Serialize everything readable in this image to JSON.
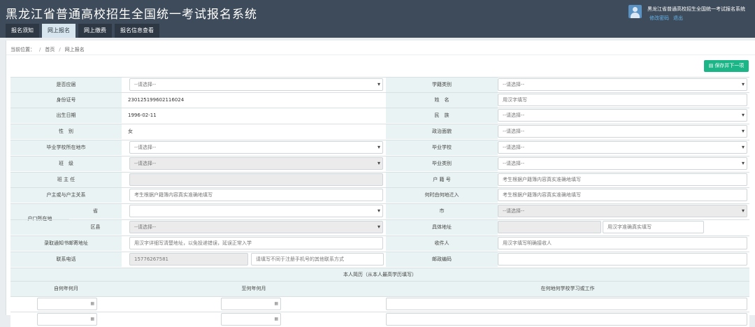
{
  "header": {
    "title": "黑龙江省普通高校招生全国统一考试报名系统",
    "user_name": "黑龙江省普通高校招生全国统一考试报名系统",
    "link_change_pwd": "修改密码",
    "link_logout": "退出"
  },
  "nav": [
    {
      "label": "报名须知",
      "active": false
    },
    {
      "label": "网上报名",
      "active": true
    },
    {
      "label": "网上缴费",
      "active": false
    },
    {
      "label": "报名信息查看",
      "active": false
    }
  ],
  "breadcrumb": {
    "prefix": "当前位置：",
    "home": "首页",
    "current": "网上报名"
  },
  "save_button": "保存并下一项",
  "placeholder_select": "--请选择--",
  "form": {
    "shifou_yingjie": {
      "label": "是否应届",
      "value": "--请选择--"
    },
    "xueji_leibie": {
      "label": "学籍类别",
      "value": "--请选择--"
    },
    "id_number": {
      "label": "身份证号",
      "value": "230125199602116024"
    },
    "name": {
      "label": "姓　名",
      "placeholder": "用汉字填写"
    },
    "birth": {
      "label": "出生日期",
      "value": "1996-02-11"
    },
    "ethnic": {
      "label": "民　族",
      "value": "--请选择--"
    },
    "gender": {
      "label": "性　别",
      "value": "女"
    },
    "politics": {
      "label": "政治面貌",
      "value": "--请选择--"
    },
    "school_location": {
      "label": "毕业学校所在地市",
      "value": "--请选择--"
    },
    "school": {
      "label": "毕业学校",
      "value": "--请选择--"
    },
    "class": {
      "label": "班　级",
      "value": "--请选择--"
    },
    "grad_type": {
      "label": "毕业类别",
      "value": "--请选择--"
    },
    "teacher": {
      "label": "班 主 任",
      "value": ""
    },
    "hukou_no": {
      "label": "户 籍 号",
      "placeholder": "考生根据户籍簿内容真实准确地填写"
    },
    "householder": {
      "label": "户主或与户主关系",
      "placeholder": "考生根据户籍簿内容真实准确地填写"
    },
    "move_in": {
      "label": "何时由何地迁入",
      "placeholder": "考生根据户籍簿内容真实准确地填写"
    },
    "hukou_location": {
      "label": "户口所在地"
    },
    "province": {
      "label": "省",
      "value": ""
    },
    "city": {
      "label": "市",
      "value": "--请选择--"
    },
    "district": {
      "label": "区县",
      "value": "--请选择--"
    },
    "street": {
      "label": "具体地址",
      "value": "",
      "placeholder": "用汉字准确真实填写"
    },
    "mail_address": {
      "label": "录取通知书邮寄地址",
      "placeholder": "用汉字详细写清楚地址，以免投递错误，延误正常入学"
    },
    "receiver": {
      "label": "收件人",
      "placeholder": "用汉字填写明确接收人"
    },
    "phone": {
      "label": "联系电话",
      "value": "15776267581",
      "placeholder2": "请填写不同于注册手机号的其他联系方式"
    },
    "postcode": {
      "label": "邮政编码",
      "value": ""
    }
  },
  "resume": {
    "title": "本人简历（从本人最高学历填写）",
    "col_from": "自何年何月",
    "col_to": "至何年何月",
    "col_where": "在何地何学校学习或工作"
  }
}
